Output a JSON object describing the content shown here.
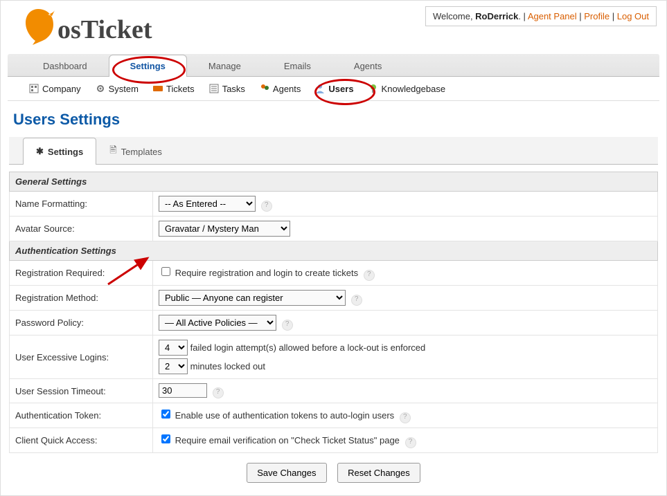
{
  "welcome": {
    "prefix": "Welcome, ",
    "username": "RoDerrick",
    "sep": ". | ",
    "agent_panel": "Agent Panel",
    "profile": "Profile",
    "logout": "Log Out"
  },
  "main_nav": {
    "dashboard": "Dashboard",
    "settings": "Settings",
    "manage": "Manage",
    "emails": "Emails",
    "agents": "Agents"
  },
  "sub_nav": {
    "company": "Company",
    "system": "System",
    "tickets": "Tickets",
    "tasks": "Tasks",
    "agents": "Agents",
    "users": "Users",
    "knowledgebase": "Knowledgebase"
  },
  "page_title": "Users Settings",
  "inner_tabs": {
    "settings": "Settings",
    "templates": "Templates"
  },
  "sections": {
    "general": "General Settings",
    "auth": "Authentication Settings"
  },
  "rows": {
    "name_formatting": {
      "label": "Name Formatting:",
      "value": "-- As Entered --"
    },
    "avatar_source": {
      "label": "Avatar Source:",
      "value": "Gravatar / Mystery Man"
    },
    "reg_required": {
      "label": "Registration Required:",
      "cb_label": "Require registration and login to create tickets"
    },
    "reg_method": {
      "label": "Registration Method:",
      "value": "Public — Anyone can register"
    },
    "pw_policy": {
      "label": "Password Policy:",
      "value": "— All Active Policies —"
    },
    "excessive": {
      "label": "User Excessive Logins:",
      "attempts_value": "4",
      "attempts_text": "failed login attempt(s) allowed before a lock-out is enforced",
      "minutes_value": "2",
      "minutes_text": "minutes locked out"
    },
    "session_timeout": {
      "label": "User Session Timeout:",
      "value": "30"
    },
    "auth_token": {
      "label": "Authentication Token:",
      "cb_label": "Enable use of authentication tokens to auto-login users"
    },
    "quick_access": {
      "label": "Client Quick Access:",
      "cb_label": "Require email verification on \"Check Ticket Status\" page"
    }
  },
  "buttons": {
    "save": "Save Changes",
    "reset": "Reset Changes"
  }
}
